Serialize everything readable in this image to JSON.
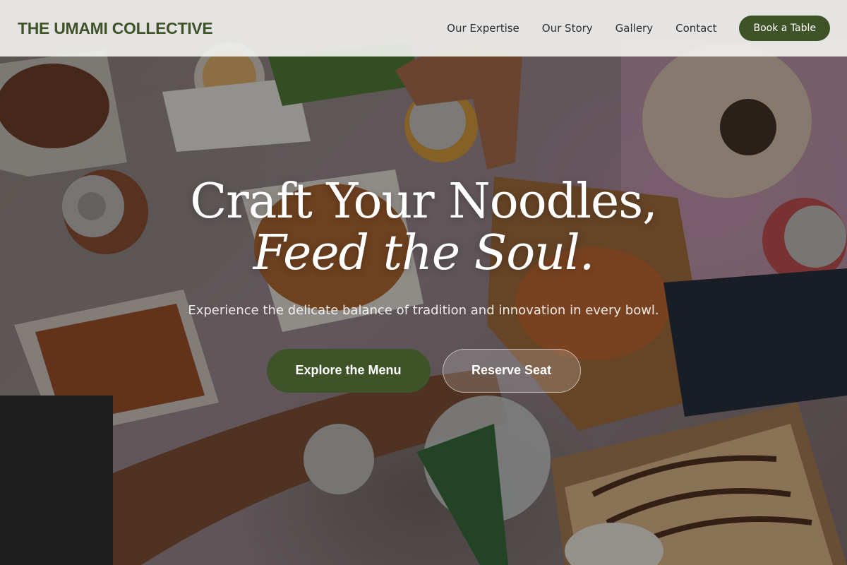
{
  "brand": {
    "name": "THE UMAMI COLLECTIVE"
  },
  "nav": {
    "links": [
      "Our Expertise",
      "Our Story",
      "Gallery",
      "Contact"
    ],
    "book_label": "Book a Table"
  },
  "hero": {
    "headline_line1": "Craft Your Noodles,",
    "headline_line2": "Feed the Soul.",
    "subtitle": "Experience the delicate balance of tradition and innovation in every bowl.",
    "primary_cta": "Explore the Menu",
    "secondary_cta": "Reserve Seat"
  },
  "colors": {
    "accent": "#3e5428",
    "navbar_bg": "#f4f4f2",
    "text_light": "#ffffff"
  }
}
